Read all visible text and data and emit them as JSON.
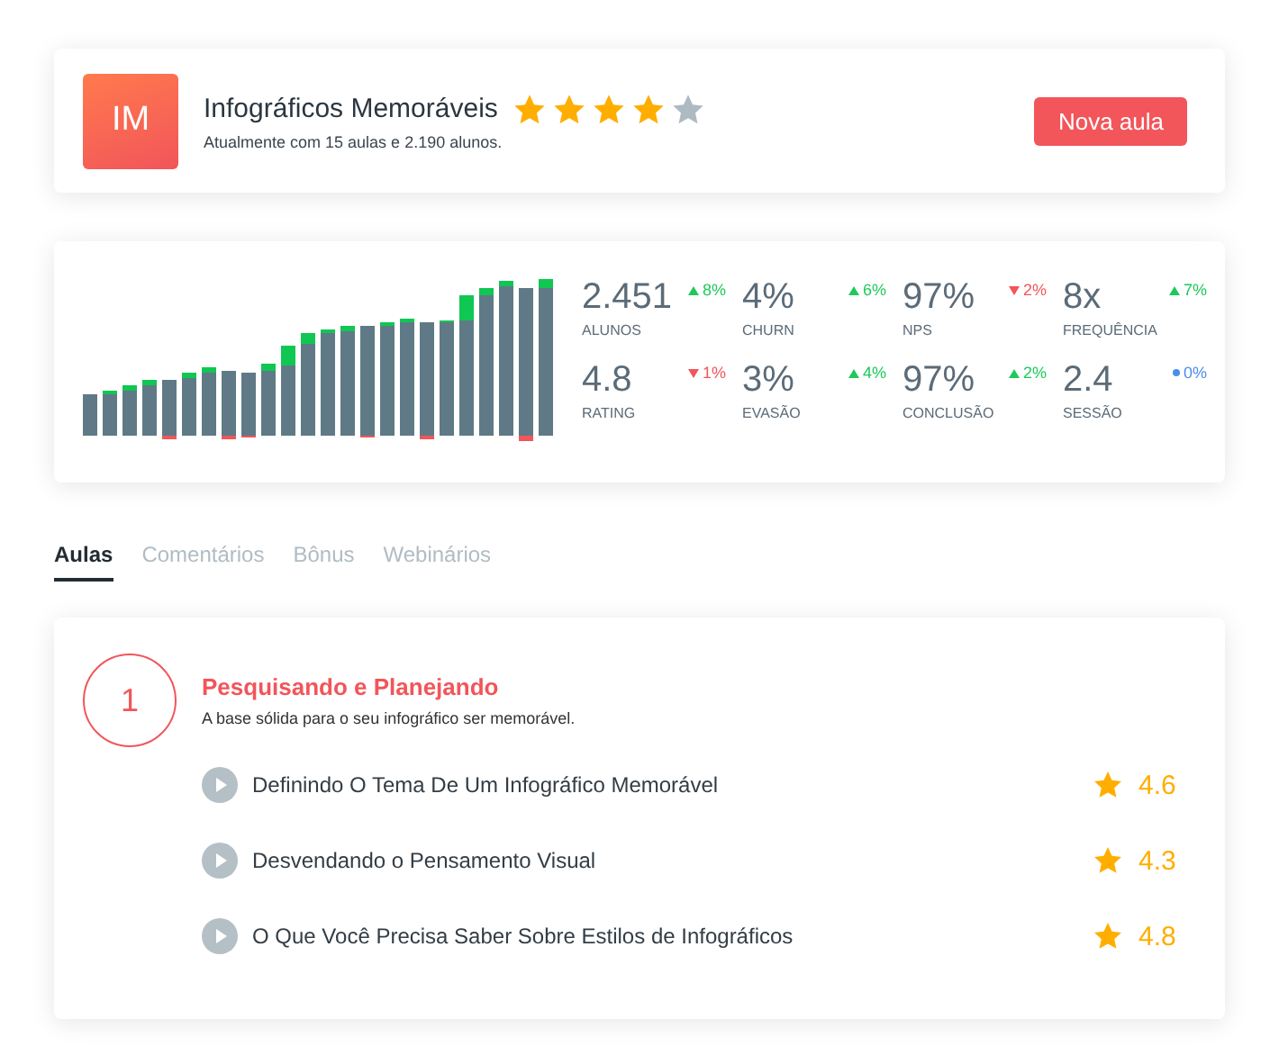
{
  "course": {
    "initials": "IM",
    "title": "Infográficos Memoráveis",
    "stars": 4,
    "subtitle": "Atualmente com 15 aulas e 2.190 alunos.",
    "button": "Nova aula"
  },
  "metrics": [
    {
      "value": "2.451",
      "label": "ALUNOS",
      "change": "8%",
      "kind": "up"
    },
    {
      "value": "4%",
      "label": "CHURN",
      "change": "6%",
      "kind": "up"
    },
    {
      "value": "97%",
      "label": "NPS",
      "change": "2%",
      "kind": "down"
    },
    {
      "value": "8x",
      "label": "FREQUÊNCIA",
      "change": "7%",
      "kind": "up"
    },
    {
      "value": "4.8",
      "label": "RATING",
      "change": "1%",
      "kind": "down"
    },
    {
      "value": "3%",
      "label": "EVASÃO",
      "change": "4%",
      "kind": "up"
    },
    {
      "value": "97%",
      "label": "CONCLUSÃO",
      "change": "2%",
      "kind": "up"
    },
    {
      "value": "2.4",
      "label": "SESSÃO",
      "change": "0%",
      "kind": "flat"
    }
  ],
  "tabs": [
    {
      "label": "Aulas",
      "selected": true
    },
    {
      "label": "Comentários",
      "selected": false
    },
    {
      "label": "Bônus",
      "selected": false
    },
    {
      "label": "Webinários",
      "selected": false
    }
  ],
  "module": {
    "number": "1",
    "title": "Pesquisando e Planejando",
    "description": "A base sólida para o seu infográfico ser memorável.",
    "lessons": [
      {
        "title": "Definindo O Tema De Um Infográfico Memorável",
        "rating": "4.6"
      },
      {
        "title": "Desvendando o Pensamento Visual",
        "rating": "4.3"
      },
      {
        "title": "O Que Você Precisa Saber Sobre Estilos de Infográficos",
        "rating": "4.8"
      }
    ]
  }
}
